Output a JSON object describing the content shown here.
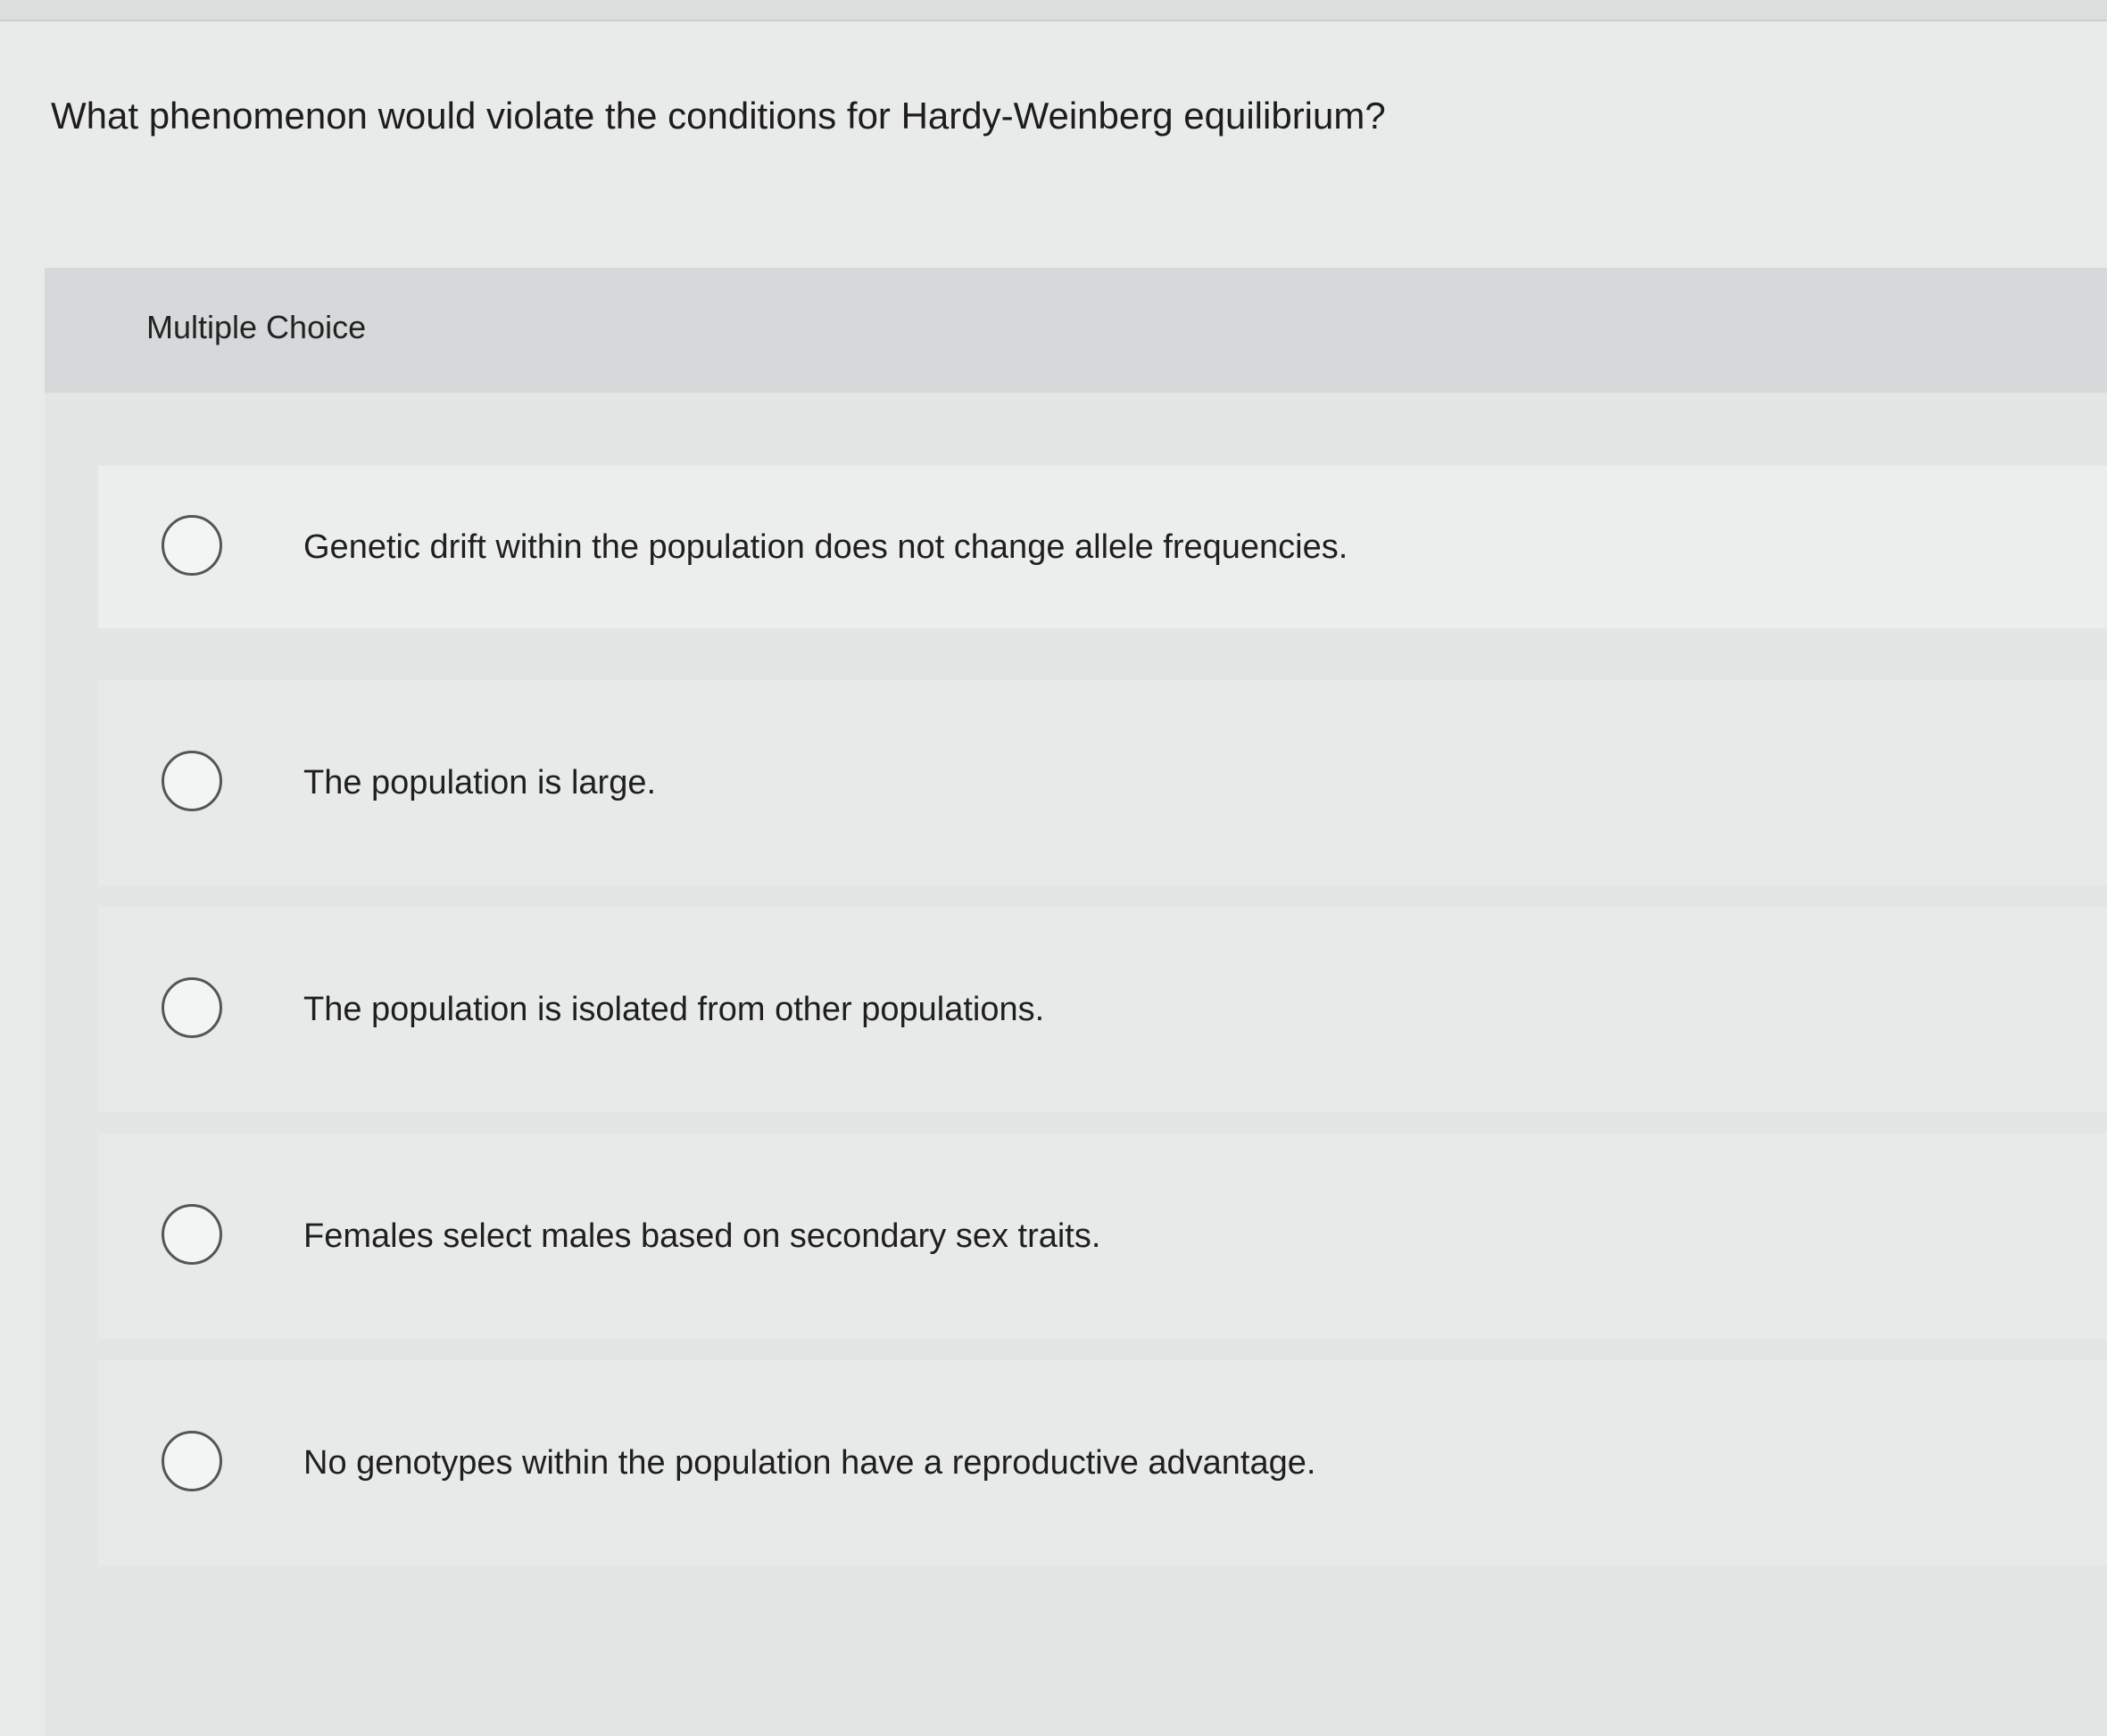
{
  "question": {
    "text": "What phenomenon would violate the conditions for Hardy-Weinberg equilibrium?"
  },
  "multiple_choice": {
    "label": "Multiple Choice",
    "options": [
      {
        "text": "Genetic drift within the population does not change allele frequencies.",
        "selected": false
      },
      {
        "text": "The population is large.",
        "selected": false
      },
      {
        "text": "The population is isolated from other populations.",
        "selected": false
      },
      {
        "text": "Females select males based on secondary sex traits.",
        "selected": false
      },
      {
        "text": "No genotypes within the population have a reproductive advantage.",
        "selected": false
      }
    ]
  }
}
